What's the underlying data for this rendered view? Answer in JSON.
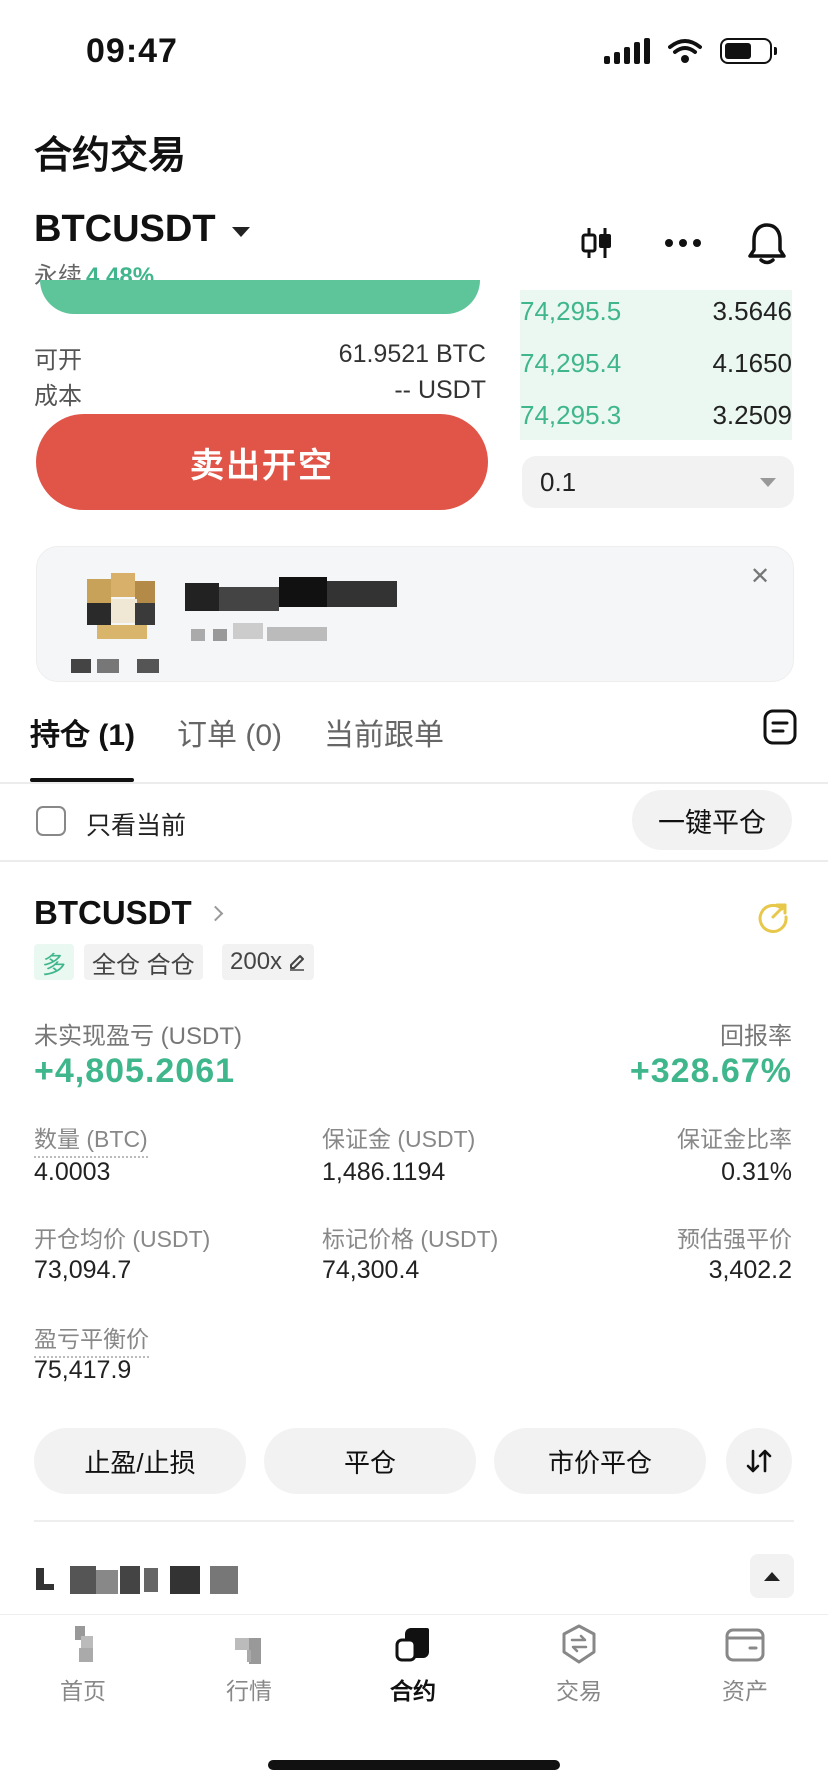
{
  "status_bar": {
    "time": "09:47"
  },
  "header": {
    "title": "合约交易"
  },
  "pair": {
    "symbol": "BTCUSDT",
    "type": "永续",
    "change": "4.48%"
  },
  "top_icons": [
    "candlestick-icon",
    "more-icon",
    "bell-icon"
  ],
  "order_form": {
    "available_label": "可开",
    "available_value": "61.9521 BTC",
    "cost_label": "成本",
    "cost_value": "-- USDT",
    "sell_button": "卖出开空"
  },
  "order_book": {
    "rows": [
      {
        "price": "74,295.5",
        "qty": "3.5646"
      },
      {
        "price": "74,295.4",
        "qty": "4.1650"
      },
      {
        "price": "74,295.3",
        "qty": "3.2509"
      }
    ],
    "precision": "0.1"
  },
  "tabs": [
    {
      "label": "持仓 (1)",
      "active": true
    },
    {
      "label": "订单 (0)",
      "active": false
    },
    {
      "label": "当前跟单",
      "active": false
    }
  ],
  "filter": {
    "only_current": "只看当前",
    "close_all": "一键平仓"
  },
  "position": {
    "symbol": "BTCUSDT",
    "side": "多",
    "mode": "全仓 合仓",
    "leverage": "200x",
    "pnl_label": "未实现盈亏 (USDT)",
    "pnl_value": "+4,805.2061",
    "roi_label": "回报率",
    "roi_value": "+328.67%",
    "fields": [
      {
        "label": "数量 (BTC)",
        "value": "4.0003"
      },
      {
        "label": "保证金 (USDT)",
        "value": "1,486.1194"
      },
      {
        "label": "保证金比率",
        "value": "0.31%"
      },
      {
        "label": "开仓均价 (USDT)",
        "value": "73,094.7"
      },
      {
        "label": "标记价格 (USDT)",
        "value": "74,300.4"
      },
      {
        "label": "预估强平价",
        "value": "3,402.2"
      },
      {
        "label": "盈亏平衡价",
        "value": "75,417.9"
      }
    ],
    "actions": [
      "止盈/止损",
      "平仓",
      "市价平仓"
    ]
  },
  "bottom_nav": [
    {
      "label": "首页",
      "icon": "home-icon",
      "active": false
    },
    {
      "label": "行情",
      "icon": "market-icon",
      "active": false
    },
    {
      "label": "合约",
      "icon": "futures-icon",
      "active": true
    },
    {
      "label": "交易",
      "icon": "trade-icon",
      "active": false
    },
    {
      "label": "资产",
      "icon": "wallet-icon",
      "active": false
    }
  ],
  "colors": {
    "green": "#3fb68b",
    "red": "#e05548",
    "accent_yellow": "#e8c84a"
  }
}
